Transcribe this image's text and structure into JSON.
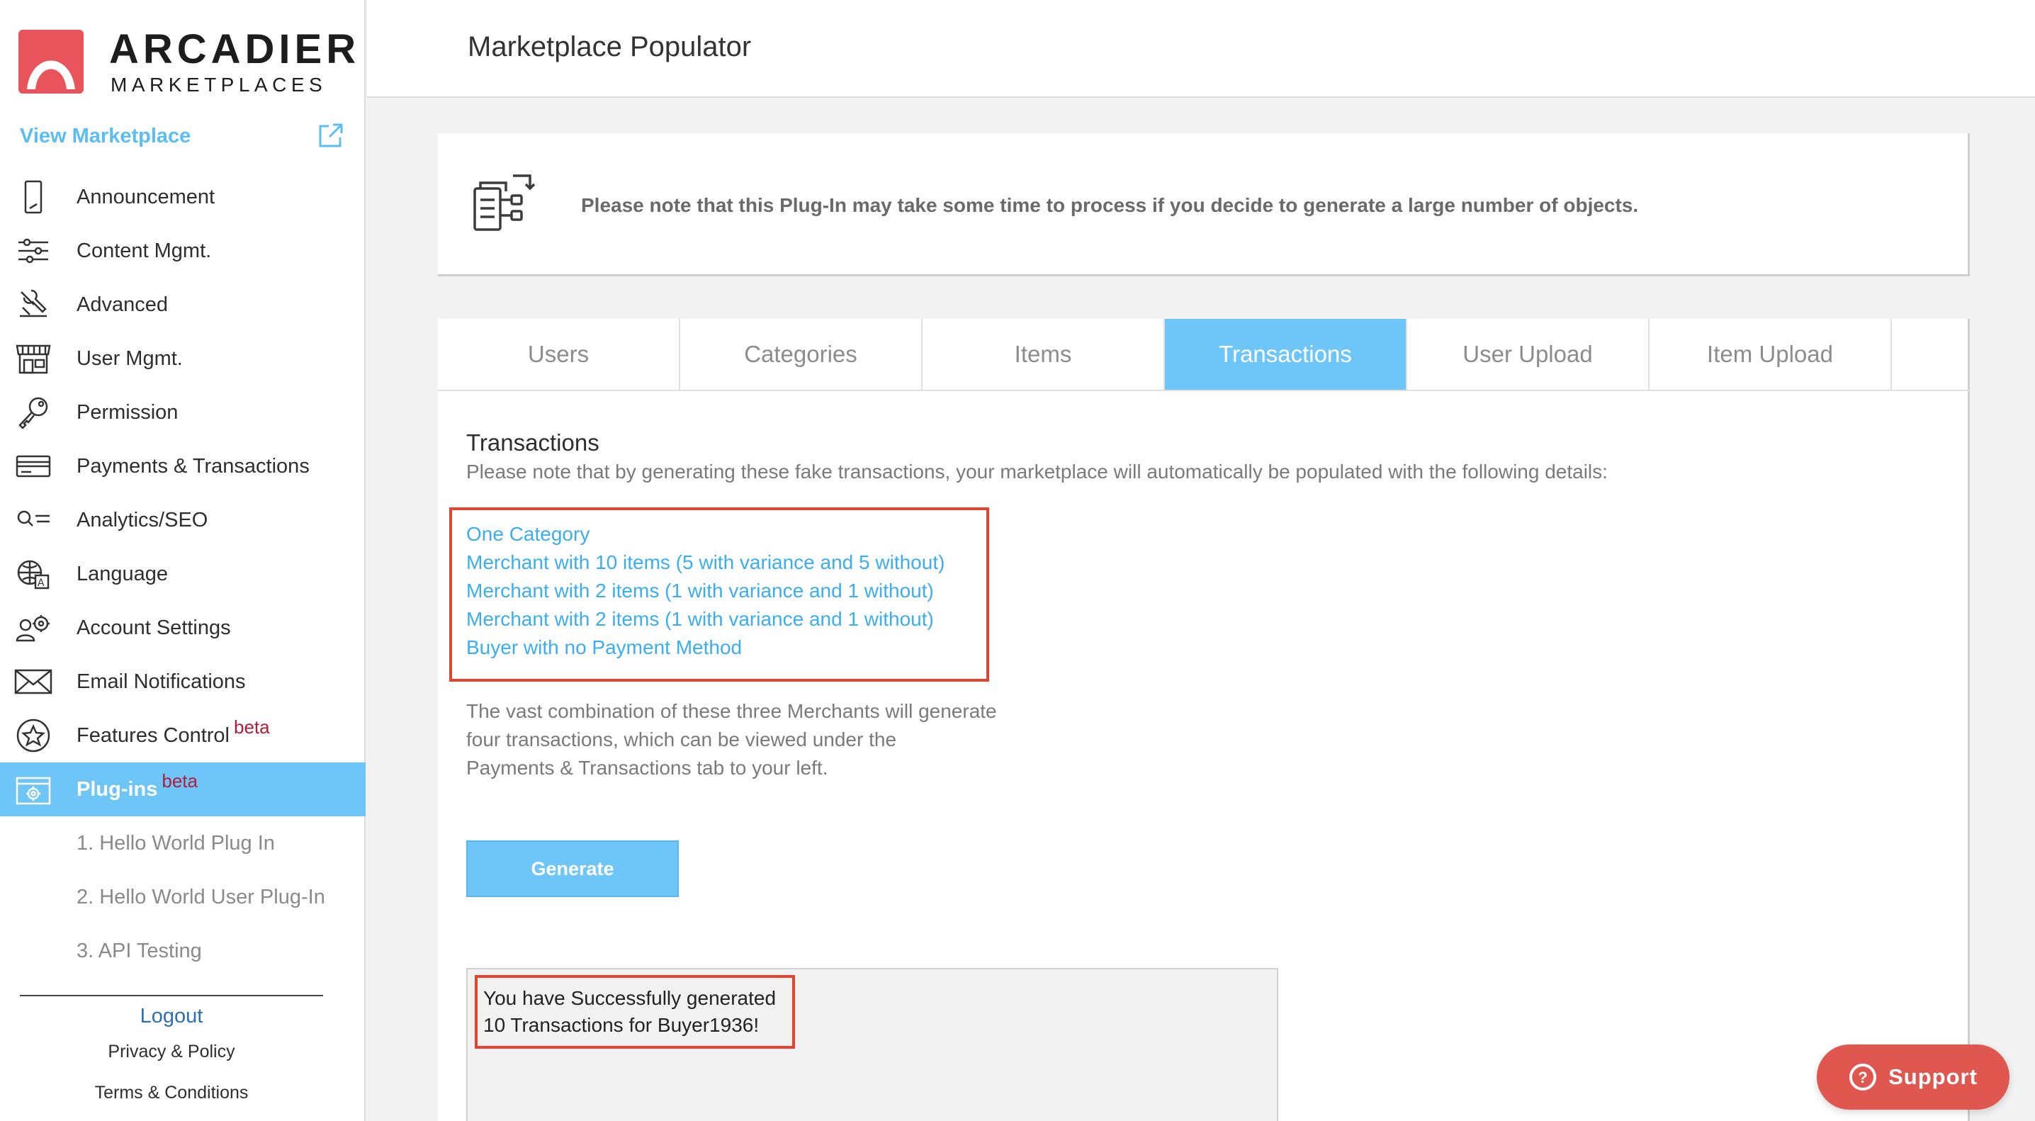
{
  "brand": {
    "name": "ARCADIER",
    "sub": "MARKETPLACES",
    "accent": "#e9535b"
  },
  "sidebar": {
    "view_marketplace": "View Marketplace",
    "items": [
      {
        "label": "Announcement",
        "icon": "tablet-icon"
      },
      {
        "label": "Content Mgmt.",
        "icon": "sliders-icon"
      },
      {
        "label": "Advanced",
        "icon": "wrench-icon"
      },
      {
        "label": "User Mgmt.",
        "icon": "store-icon"
      },
      {
        "label": "Permission",
        "icon": "key-icon"
      },
      {
        "label": "Payments & Transactions",
        "icon": "card-icon"
      },
      {
        "label": "Analytics/SEO",
        "icon": "magnifier-icon"
      },
      {
        "label": "Language",
        "icon": "globe-icon"
      },
      {
        "label": "Account Settings",
        "icon": "users-gear-icon"
      },
      {
        "label": "Email Notifications",
        "icon": "envelope-icon"
      },
      {
        "label": "Features Control",
        "badge": "beta",
        "icon": "star-icon"
      },
      {
        "label": "Plug-ins",
        "badge": "beta",
        "icon": "plugin-icon",
        "active": true
      }
    ],
    "sub_items": [
      {
        "label": "1. Hello World Plug In"
      },
      {
        "label": "2. Hello World User Plug-In"
      },
      {
        "label": "3. API Testing"
      }
    ],
    "logout": "Logout",
    "privacy": "Privacy & Policy",
    "terms": "Terms & Conditions"
  },
  "header": {
    "title": "Marketplace Populator"
  },
  "notice": {
    "text": "Please note that this Plug-In may take some time to process if you decide to generate a large number of objects."
  },
  "tabs": [
    {
      "label": "Users"
    },
    {
      "label": "Categories"
    },
    {
      "label": "Items"
    },
    {
      "label": "Transactions",
      "active": true
    },
    {
      "label": "User Upload"
    },
    {
      "label": "Item Upload"
    }
  ],
  "transactions": {
    "title": "Transactions",
    "description": "Please note that by generating these fake transactions, your marketplace will automatically be populated with the following details:",
    "details": [
      "One Category",
      "Merchant with 10 items (5 with variance and 5 without)",
      "Merchant with 2 items (1 with variance and 1 without)",
      "Merchant with 2 items (1 with variance and 1 without)",
      "Buyer with no Payment Method"
    ],
    "combination_lines": [
      "The vast combination of these three Merchants will generate",
      "four transactions, which can be viewed under the",
      "Payments & Transactions tab to your left."
    ],
    "generate_label": "Generate",
    "result_lines": [
      "You have Successfully generated",
      "10 Transactions for Buyer1936!"
    ]
  },
  "support": {
    "label": "Support",
    "icon": "question-icon"
  },
  "colors": {
    "active": "#6ec6f8",
    "link": "#3aaef0",
    "highlight": "#e0462f",
    "support": "#e0574f"
  }
}
